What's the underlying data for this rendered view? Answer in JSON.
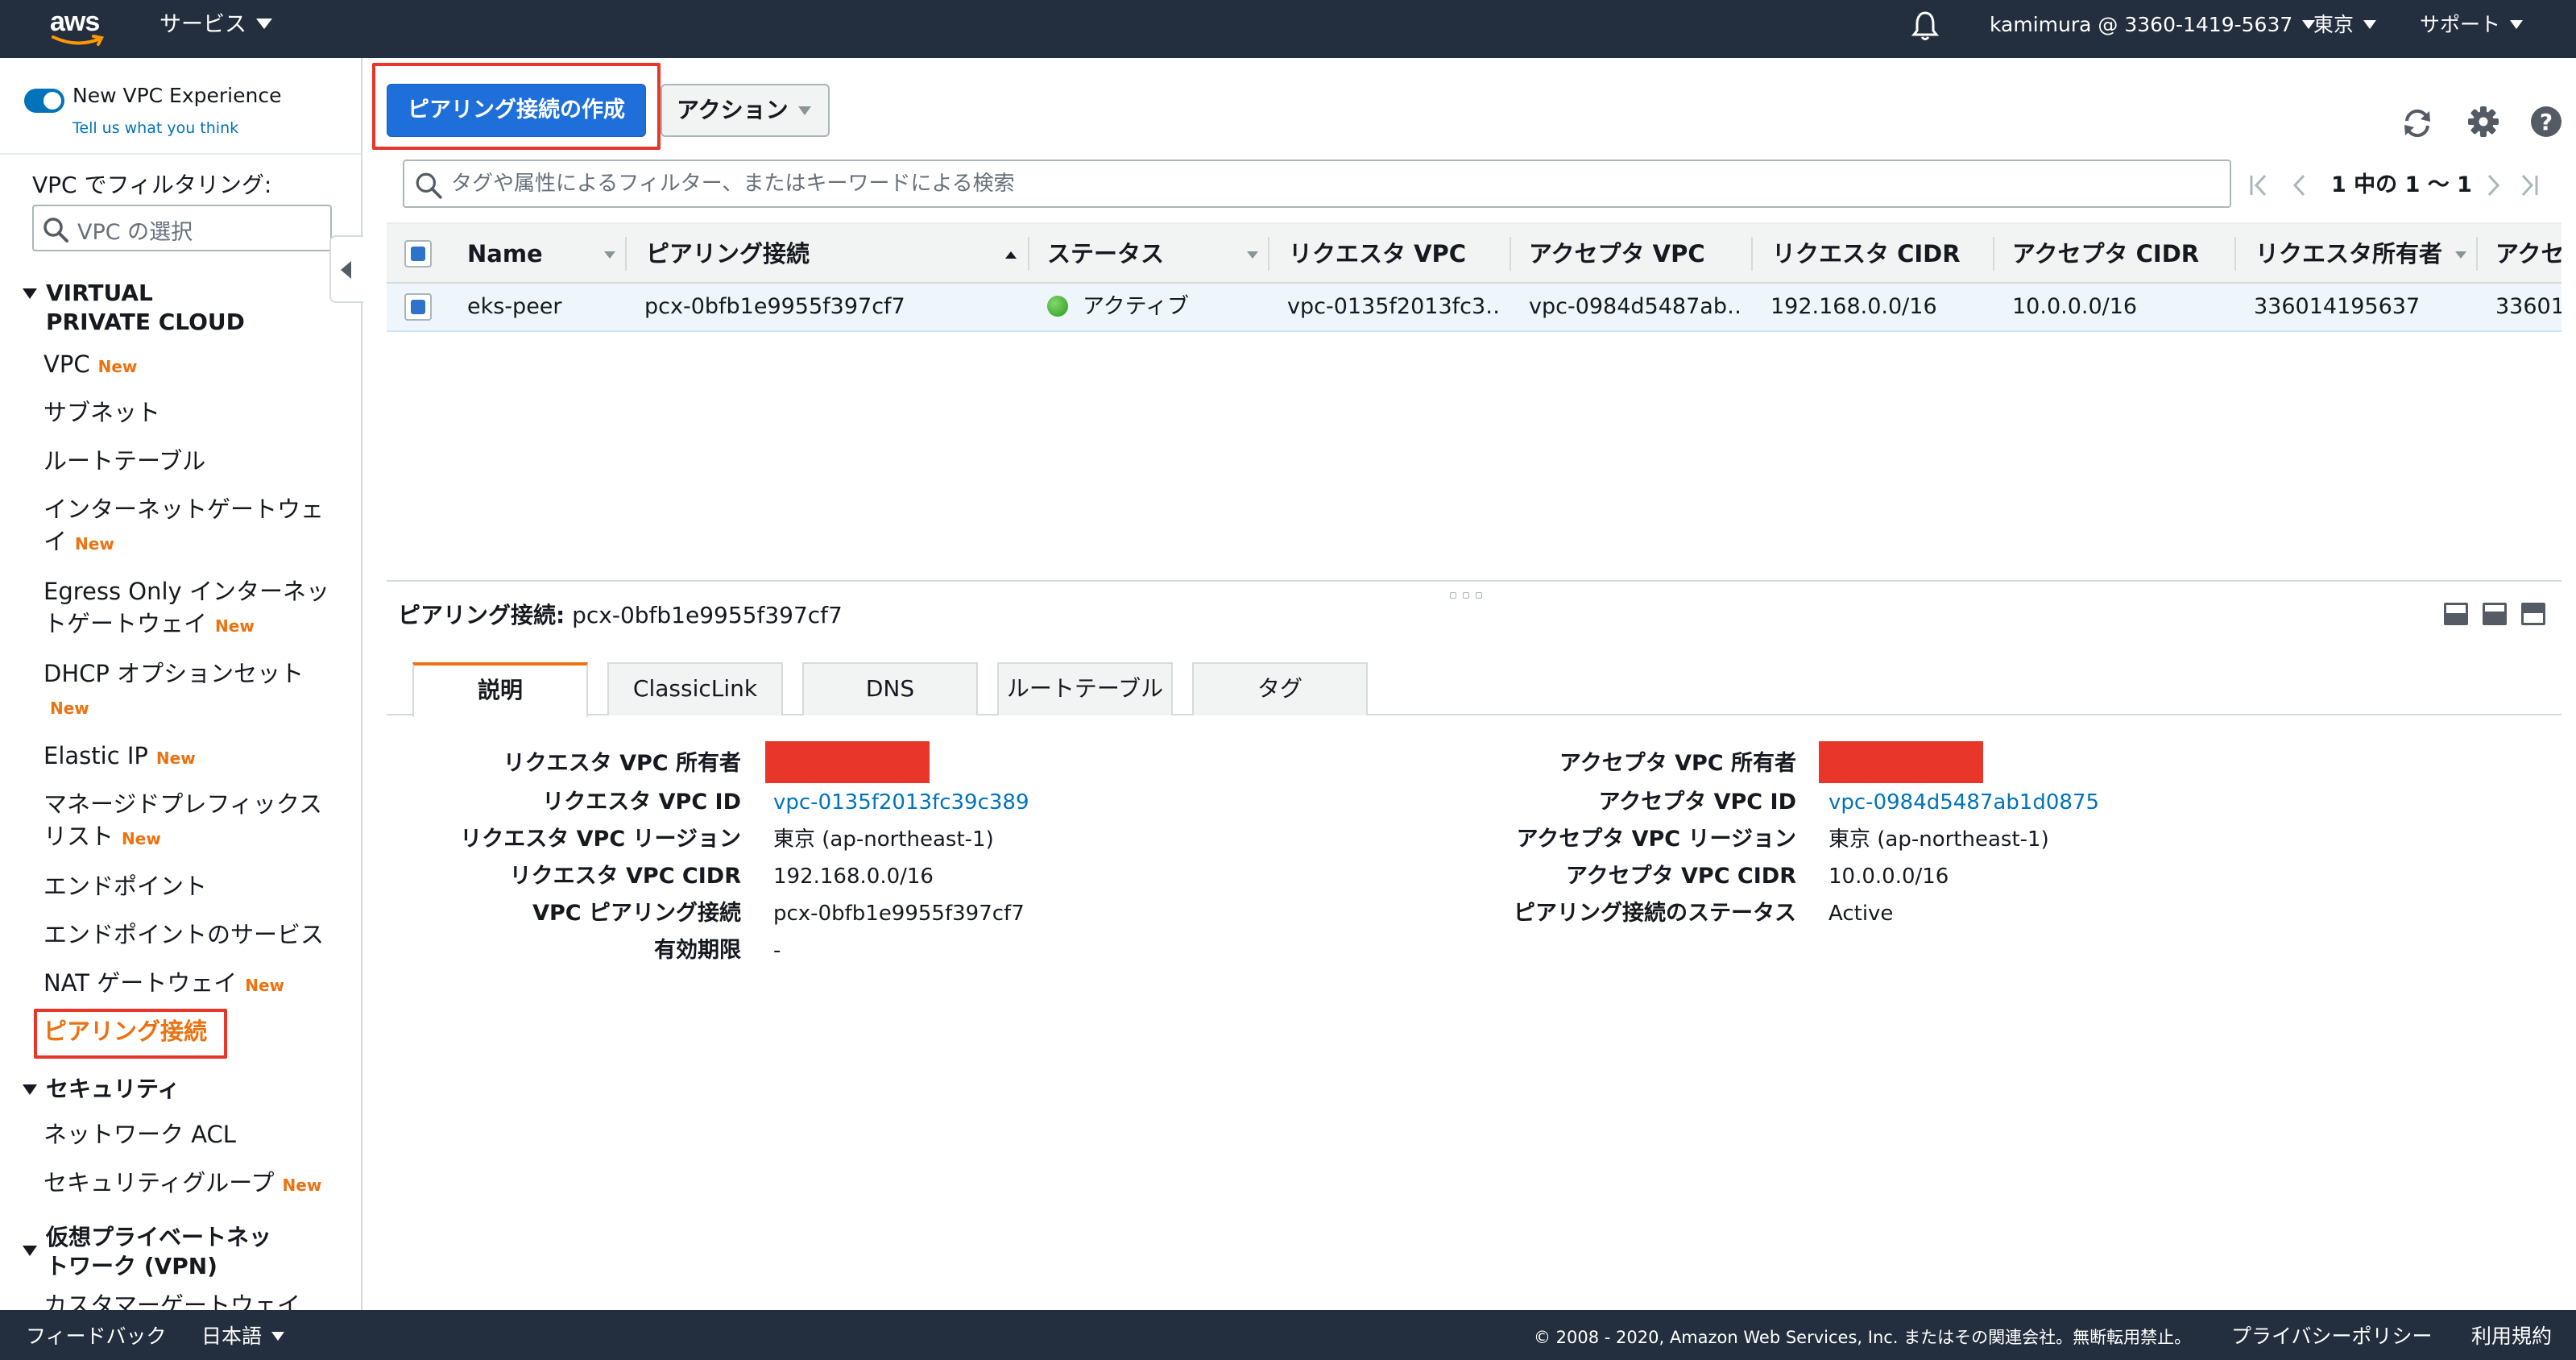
{
  "topnav": {
    "logo_text": "aws",
    "services_label": "サービス",
    "account_label": "kamimura @ 3360-1419-5637",
    "region_label": "東京",
    "support_label": "サポート"
  },
  "sidebar": {
    "new_vpc_experience": "New VPC Experience",
    "feedback_link": "Tell us what you think",
    "filter_label": "VPC でフィルタリング:",
    "filter_placeholder": "VPC の選択",
    "new_badge": "New",
    "section_vpc": "VIRTUAL PRIVATE CLOUD",
    "items": [
      {
        "label": "VPC",
        "new": true
      },
      {
        "label": "サブネット",
        "new": false
      },
      {
        "label": "ルートテーブル",
        "new": false
      },
      {
        "label": "インターネットゲートウェイ",
        "new": true
      },
      {
        "label": "Egress Only インターネットゲートウェイ",
        "new": true
      },
      {
        "label": "DHCP オプションセット",
        "new": true
      },
      {
        "label": "Elastic IP",
        "new": true
      },
      {
        "label": "マネージドプレフィックスリスト",
        "new": true
      },
      {
        "label": "エンドポイント",
        "new": false
      },
      {
        "label": "エンドポイントのサービス",
        "new": false
      },
      {
        "label": "NAT ゲートウェイ",
        "new": true
      },
      {
        "label": "ピアリング接続",
        "new": false,
        "active": true
      }
    ],
    "section_security": "セキュリティ",
    "security_items": [
      {
        "label": "ネットワーク ACL",
        "new": false
      },
      {
        "label": "セキュリティグループ",
        "new": true
      }
    ],
    "section_vpn": "仮想プライベートネットワーク (VPN)",
    "vpn_items": [
      {
        "label": "カスタマーゲートウェイ"
      }
    ]
  },
  "toolbar": {
    "create_label": "ピアリング接続の作成",
    "actions_label": "アクション"
  },
  "search": {
    "placeholder": "タグや属性によるフィルター、またはキーワードによる検索"
  },
  "pagination": {
    "label": "1 中の 1 〜 1"
  },
  "table": {
    "columns": [
      "Name",
      "ピアリング接続",
      "ステータス",
      "リクエスタ VPC",
      "アクセプタ VPC",
      "リクエスタ CIDR",
      "アクセプタ CIDR",
      "リクエスタ所有者",
      "アクセ"
    ],
    "row": {
      "name": "eks-peer",
      "peering_id": "pcx-0bfb1e9955f397cf7",
      "status": "アクティブ",
      "requester_vpc": "vpc-0135f2013fc3…",
      "accepter_vpc": "vpc-0984d5487ab…",
      "requester_cidr": "192.168.0.0/16",
      "accepter_cidr": "10.0.0.0/16",
      "requester_owner": "336014195637",
      "accepter_owner": "33601"
    }
  },
  "detail": {
    "title_label": "ピアリング接続:",
    "title_value": "pcx-0bfb1e9955f397cf7",
    "tabs": [
      "説明",
      "ClassicLink",
      "DNS",
      "ルートテーブル",
      "タグ"
    ],
    "left": [
      {
        "label": "リクエスタ VPC 所有者",
        "value": ""
      },
      {
        "label": "リクエスタ VPC ID",
        "value": "vpc-0135f2013fc39c389"
      },
      {
        "label": "リクエスタ VPC リージョン",
        "value": "東京 (ap-northeast-1)"
      },
      {
        "label": "リクエスタ VPC CIDR",
        "value": "192.168.0.0/16"
      },
      {
        "label": "VPC ピアリング接続",
        "value": "pcx-0bfb1e9955f397cf7"
      },
      {
        "label": "有効期限",
        "value": "-"
      }
    ],
    "right": [
      {
        "label": "アクセプタ VPC 所有者",
        "value": ""
      },
      {
        "label": "アクセプタ VPC ID",
        "value": "vpc-0984d5487ab1d0875"
      },
      {
        "label": "アクセプタ VPC リージョン",
        "value": "東京 (ap-northeast-1)"
      },
      {
        "label": "アクセプタ VPC CIDR",
        "value": "10.0.0.0/16"
      },
      {
        "label": "ピアリング接続のステータス",
        "value": "Active"
      }
    ]
  },
  "footer": {
    "feedback": "フィードバック",
    "language": "日本語",
    "copyright": "© 2008 - 2020, Amazon Web Services, Inc. またはその関連会社。無断転用禁止。",
    "privacy": "プライバシーポリシー",
    "terms": "利用規約"
  },
  "colors": {
    "nav_bg": "#232f3e",
    "primary_button": "#1e6fd9",
    "new_badge": "#ec7211",
    "active_nav": "#ec7211",
    "highlight": "#e8362a",
    "link": "#0073bb"
  }
}
